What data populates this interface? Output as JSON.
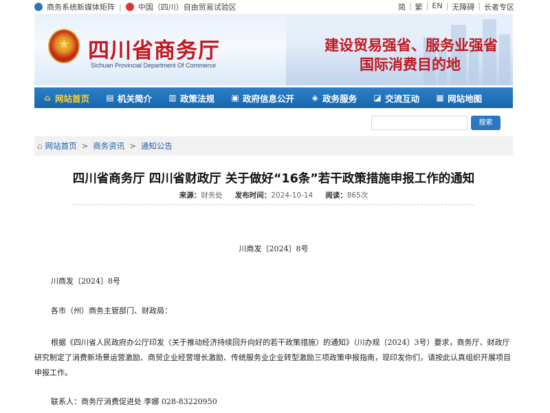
{
  "topbar": {
    "left_item1": "商务系统新媒体矩阵",
    "left_item2": "中国（四川）自由贸易试验区",
    "right_links": [
      "简",
      "繁",
      "EN",
      "无障碍",
      "长者专区"
    ]
  },
  "header": {
    "org_name": "四川省商务厅",
    "org_name_en": "Sichuan Provincial Department Of Commerce",
    "slogan_line1": "建设贸易强省、服务业强省",
    "slogan_line2": "国际消费目的地"
  },
  "nav": {
    "items": [
      {
        "label": "网站首页",
        "icon": "home-icon"
      },
      {
        "label": "机关简介",
        "icon": "document-icon"
      },
      {
        "label": "政策法规",
        "icon": "book-icon"
      },
      {
        "label": "政府信息公开",
        "icon": "info-icon"
      },
      {
        "label": "政务服务",
        "icon": "service-icon"
      },
      {
        "label": "交流互动",
        "icon": "chat-icon"
      },
      {
        "label": "网站地图",
        "icon": "map-icon"
      }
    ]
  },
  "search": {
    "placeholder": "",
    "button_label": "搜索"
  },
  "breadcrumb": {
    "items": [
      "网站首页",
      "商务资讯",
      "通知公告"
    ]
  },
  "article": {
    "title": "四川省商务厅 四川省财政厅 关于做好“16条”若干政策措施申报工作的通知",
    "source_label": "来源：",
    "source": "财务处",
    "date_label": "发布时间：",
    "date": "2024-10-14",
    "views_label": "阅读：",
    "views": "865次",
    "doc_number": "川商发〔2024〕8号",
    "paragraph1": "川商发〔2024〕8号",
    "paragraph2": "各市（州）商务主管部门、财政局：",
    "paragraph3": "根据《四川省人民政府办公厅印发〈关于推动经济持续回升向好的若干政策措施〉的通知》（川办规〔2024〕3号）要求，商务厅、财政厅研究制定了消费新场景运营激励、商贸企业经营增长激励、传统服务业企业转型激励三项政策申报指南，现印发你们，请按此认真组织开展项目申报工作。",
    "contact": "联系人：商务厅消费促进处 李娜 028-83220950"
  },
  "colors": {
    "nav_bg": "#1f72bb",
    "nav_active": "#ffd02b",
    "brand_red": "#c2181f",
    "link_blue": "#1f5fa8"
  }
}
